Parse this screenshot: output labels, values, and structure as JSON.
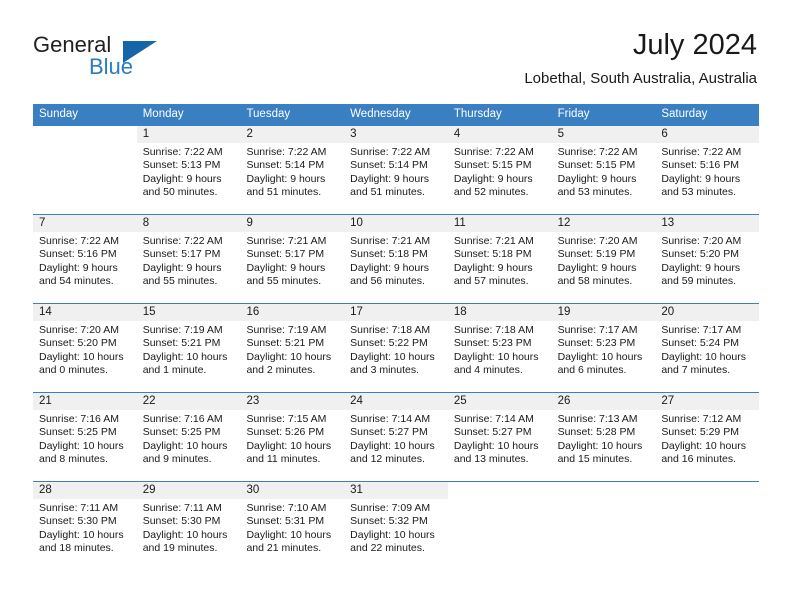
{
  "brand": {
    "name_part1": "General",
    "name_part2": "Blue",
    "logo_icon": "triangle-logo-icon",
    "accent_color": "#1565a8",
    "blue_text_color": "#2a7bc0"
  },
  "header": {
    "title": "July 2024",
    "subtitle": "Lobethal, South Australia, Australia"
  },
  "calendar": {
    "header_bg_color": "#3a7fc1",
    "day_number_bg_color": "#f0f0f0",
    "weekdays": [
      "Sunday",
      "Monday",
      "Tuesday",
      "Wednesday",
      "Thursday",
      "Friday",
      "Saturday"
    ],
    "weeks": [
      [
        {
          "day": "",
          "sunrise": "",
          "sunset": "",
          "daylight_line1": "",
          "daylight_line2": ""
        },
        {
          "day": "1",
          "sunrise": "Sunrise: 7:22 AM",
          "sunset": "Sunset: 5:13 PM",
          "daylight_line1": "Daylight: 9 hours",
          "daylight_line2": "and 50 minutes."
        },
        {
          "day": "2",
          "sunrise": "Sunrise: 7:22 AM",
          "sunset": "Sunset: 5:14 PM",
          "daylight_line1": "Daylight: 9 hours",
          "daylight_line2": "and 51 minutes."
        },
        {
          "day": "3",
          "sunrise": "Sunrise: 7:22 AM",
          "sunset": "Sunset: 5:14 PM",
          "daylight_line1": "Daylight: 9 hours",
          "daylight_line2": "and 51 minutes."
        },
        {
          "day": "4",
          "sunrise": "Sunrise: 7:22 AM",
          "sunset": "Sunset: 5:15 PM",
          "daylight_line1": "Daylight: 9 hours",
          "daylight_line2": "and 52 minutes."
        },
        {
          "day": "5",
          "sunrise": "Sunrise: 7:22 AM",
          "sunset": "Sunset: 5:15 PM",
          "daylight_line1": "Daylight: 9 hours",
          "daylight_line2": "and 53 minutes."
        },
        {
          "day": "6",
          "sunrise": "Sunrise: 7:22 AM",
          "sunset": "Sunset: 5:16 PM",
          "daylight_line1": "Daylight: 9 hours",
          "daylight_line2": "and 53 minutes."
        }
      ],
      [
        {
          "day": "7",
          "sunrise": "Sunrise: 7:22 AM",
          "sunset": "Sunset: 5:16 PM",
          "daylight_line1": "Daylight: 9 hours",
          "daylight_line2": "and 54 minutes."
        },
        {
          "day": "8",
          "sunrise": "Sunrise: 7:22 AM",
          "sunset": "Sunset: 5:17 PM",
          "daylight_line1": "Daylight: 9 hours",
          "daylight_line2": "and 55 minutes."
        },
        {
          "day": "9",
          "sunrise": "Sunrise: 7:21 AM",
          "sunset": "Sunset: 5:17 PM",
          "daylight_line1": "Daylight: 9 hours",
          "daylight_line2": "and 55 minutes."
        },
        {
          "day": "10",
          "sunrise": "Sunrise: 7:21 AM",
          "sunset": "Sunset: 5:18 PM",
          "daylight_line1": "Daylight: 9 hours",
          "daylight_line2": "and 56 minutes."
        },
        {
          "day": "11",
          "sunrise": "Sunrise: 7:21 AM",
          "sunset": "Sunset: 5:18 PM",
          "daylight_line1": "Daylight: 9 hours",
          "daylight_line2": "and 57 minutes."
        },
        {
          "day": "12",
          "sunrise": "Sunrise: 7:20 AM",
          "sunset": "Sunset: 5:19 PM",
          "daylight_line1": "Daylight: 9 hours",
          "daylight_line2": "and 58 minutes."
        },
        {
          "day": "13",
          "sunrise": "Sunrise: 7:20 AM",
          "sunset": "Sunset: 5:20 PM",
          "daylight_line1": "Daylight: 9 hours",
          "daylight_line2": "and 59 minutes."
        }
      ],
      [
        {
          "day": "14",
          "sunrise": "Sunrise: 7:20 AM",
          "sunset": "Sunset: 5:20 PM",
          "daylight_line1": "Daylight: 10 hours",
          "daylight_line2": "and 0 minutes."
        },
        {
          "day": "15",
          "sunrise": "Sunrise: 7:19 AM",
          "sunset": "Sunset: 5:21 PM",
          "daylight_line1": "Daylight: 10 hours",
          "daylight_line2": "and 1 minute."
        },
        {
          "day": "16",
          "sunrise": "Sunrise: 7:19 AM",
          "sunset": "Sunset: 5:21 PM",
          "daylight_line1": "Daylight: 10 hours",
          "daylight_line2": "and 2 minutes."
        },
        {
          "day": "17",
          "sunrise": "Sunrise: 7:18 AM",
          "sunset": "Sunset: 5:22 PM",
          "daylight_line1": "Daylight: 10 hours",
          "daylight_line2": "and 3 minutes."
        },
        {
          "day": "18",
          "sunrise": "Sunrise: 7:18 AM",
          "sunset": "Sunset: 5:23 PM",
          "daylight_line1": "Daylight: 10 hours",
          "daylight_line2": "and 4 minutes."
        },
        {
          "day": "19",
          "sunrise": "Sunrise: 7:17 AM",
          "sunset": "Sunset: 5:23 PM",
          "daylight_line1": "Daylight: 10 hours",
          "daylight_line2": "and 6 minutes."
        },
        {
          "day": "20",
          "sunrise": "Sunrise: 7:17 AM",
          "sunset": "Sunset: 5:24 PM",
          "daylight_line1": "Daylight: 10 hours",
          "daylight_line2": "and 7 minutes."
        }
      ],
      [
        {
          "day": "21",
          "sunrise": "Sunrise: 7:16 AM",
          "sunset": "Sunset: 5:25 PM",
          "daylight_line1": "Daylight: 10 hours",
          "daylight_line2": "and 8 minutes."
        },
        {
          "day": "22",
          "sunrise": "Sunrise: 7:16 AM",
          "sunset": "Sunset: 5:25 PM",
          "daylight_line1": "Daylight: 10 hours",
          "daylight_line2": "and 9 minutes."
        },
        {
          "day": "23",
          "sunrise": "Sunrise: 7:15 AM",
          "sunset": "Sunset: 5:26 PM",
          "daylight_line1": "Daylight: 10 hours",
          "daylight_line2": "and 11 minutes."
        },
        {
          "day": "24",
          "sunrise": "Sunrise: 7:14 AM",
          "sunset": "Sunset: 5:27 PM",
          "daylight_line1": "Daylight: 10 hours",
          "daylight_line2": "and 12 minutes."
        },
        {
          "day": "25",
          "sunrise": "Sunrise: 7:14 AM",
          "sunset": "Sunset: 5:27 PM",
          "daylight_line1": "Daylight: 10 hours",
          "daylight_line2": "and 13 minutes."
        },
        {
          "day": "26",
          "sunrise": "Sunrise: 7:13 AM",
          "sunset": "Sunset: 5:28 PM",
          "daylight_line1": "Daylight: 10 hours",
          "daylight_line2": "and 15 minutes."
        },
        {
          "day": "27",
          "sunrise": "Sunrise: 7:12 AM",
          "sunset": "Sunset: 5:29 PM",
          "daylight_line1": "Daylight: 10 hours",
          "daylight_line2": "and 16 minutes."
        }
      ],
      [
        {
          "day": "28",
          "sunrise": "Sunrise: 7:11 AM",
          "sunset": "Sunset: 5:30 PM",
          "daylight_line1": "Daylight: 10 hours",
          "daylight_line2": "and 18 minutes."
        },
        {
          "day": "29",
          "sunrise": "Sunrise: 7:11 AM",
          "sunset": "Sunset: 5:30 PM",
          "daylight_line1": "Daylight: 10 hours",
          "daylight_line2": "and 19 minutes."
        },
        {
          "day": "30",
          "sunrise": "Sunrise: 7:10 AM",
          "sunset": "Sunset: 5:31 PM",
          "daylight_line1": "Daylight: 10 hours",
          "daylight_line2": "and 21 minutes."
        },
        {
          "day": "31",
          "sunrise": "Sunrise: 7:09 AM",
          "sunset": "Sunset: 5:32 PM",
          "daylight_line1": "Daylight: 10 hours",
          "daylight_line2": "and 22 minutes."
        },
        {
          "day": "",
          "sunrise": "",
          "sunset": "",
          "daylight_line1": "",
          "daylight_line2": ""
        },
        {
          "day": "",
          "sunrise": "",
          "sunset": "",
          "daylight_line1": "",
          "daylight_line2": ""
        },
        {
          "day": "",
          "sunrise": "",
          "sunset": "",
          "daylight_line1": "",
          "daylight_line2": ""
        }
      ]
    ]
  }
}
